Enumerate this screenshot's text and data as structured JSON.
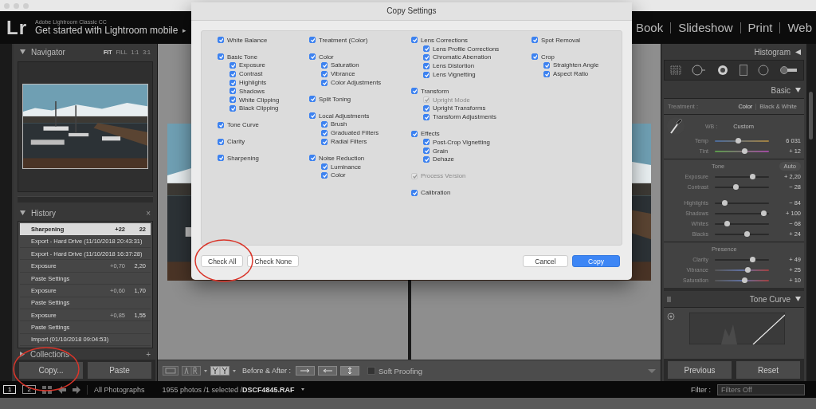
{
  "header": {
    "logo": "Lr",
    "product": "Adobe Lightroom Classic CC",
    "tagline": "Get started with Lightroom mobile",
    "tagline_arrow": "▸",
    "modules": [
      {
        "label": "Book",
        "selected": false
      },
      {
        "label": "Slideshow",
        "selected": false
      },
      {
        "label": "Print",
        "selected": false
      },
      {
        "label": "Web",
        "selected": false
      }
    ]
  },
  "navigator": {
    "title": "Navigator",
    "zoom_options": [
      {
        "label": "FIT",
        "selected": true
      },
      {
        "label": "FILL",
        "selected": false
      },
      {
        "label": "1:1",
        "selected": false
      },
      {
        "label": "3:1",
        "selected": false
      }
    ]
  },
  "history": {
    "title": "History",
    "close": "×",
    "items": [
      {
        "label": "Sharpening",
        "change": "+22",
        "value": "22",
        "selected": true
      },
      {
        "label": "Export - Hard Drive (11/10/2018 20:43:31)",
        "selected": false
      },
      {
        "label": "Export - Hard Drive (11/10/2018 16:37:28)",
        "selected": false
      },
      {
        "label": "Exposure",
        "change": "+0,70",
        "value": "2,20",
        "selected": false
      },
      {
        "label": "Paste Settings",
        "selected": false
      },
      {
        "label": "Exposure",
        "change": "+0,60",
        "value": "1,70",
        "selected": false
      },
      {
        "label": "Paste Settings",
        "selected": false
      },
      {
        "label": "Exposure",
        "change": "+0,85",
        "value": "1,55",
        "selected": false
      },
      {
        "label": "Paste Settings",
        "selected": false
      },
      {
        "label": "Import (01/10/2018 09:04:53)",
        "selected": false
      }
    ]
  },
  "collections": {
    "title": "Collections",
    "add": "+"
  },
  "left_buttons": [
    "Copy...",
    "Paste"
  ],
  "dialog": {
    "title": "Copy Settings",
    "columns": [
      [
        {
          "label": "White Balance",
          "checked": true
        },
        {
          "label": "Basic Tone",
          "checked": true,
          "children": [
            {
              "label": "Exposure",
              "checked": true
            },
            {
              "label": "Contrast",
              "checked": true
            },
            {
              "label": "Highlights",
              "checked": true
            },
            {
              "label": "Shadows",
              "checked": true
            },
            {
              "label": "White Clipping",
              "checked": true
            },
            {
              "label": "Black Clipping",
              "checked": true
            }
          ]
        },
        {
          "label": "Tone Curve",
          "checked": true
        },
        {
          "label": "Clarity",
          "checked": true
        },
        {
          "label": "Sharpening",
          "checked": true
        }
      ],
      [
        {
          "label": "Treatment (Color)",
          "checked": true
        },
        {
          "label": "Color",
          "checked": true,
          "children": [
            {
              "label": "Saturation",
              "checked": true
            },
            {
              "label": "Vibrance",
              "checked": true
            },
            {
              "label": "Color Adjustments",
              "checked": true
            }
          ]
        },
        {
          "label": "Split Toning",
          "checked": true
        },
        {
          "label": "Local Adjustments",
          "checked": true,
          "children": [
            {
              "label": "Brush",
              "checked": true
            },
            {
              "label": "Graduated Filters",
              "checked": true
            },
            {
              "label": "Radial Filters",
              "checked": true
            }
          ]
        },
        {
          "label": "Noise Reduction",
          "checked": true,
          "children": [
            {
              "label": "Luminance",
              "checked": true
            },
            {
              "label": "Color",
              "checked": true
            }
          ]
        }
      ],
      [
        {
          "label": "Lens Corrections",
          "checked": true,
          "children": [
            {
              "label": "Lens Profile Corrections",
              "checked": true
            },
            {
              "label": "Chromatic Aberration",
              "checked": true
            },
            {
              "label": "Lens Distortion",
              "checked": true
            },
            {
              "label": "Lens Vignetting",
              "checked": true
            }
          ]
        },
        {
          "label": "Transform",
          "checked": true,
          "children": [
            {
              "label": "Upright Mode",
              "checked": true,
              "disabled": true
            },
            {
              "label": "Upright Transforms",
              "checked": true
            },
            {
              "label": "Transform Adjustments",
              "checked": true
            }
          ]
        },
        {
          "label": "Effects",
          "checked": true,
          "children": [
            {
              "label": "Post-Crop Vignetting",
              "checked": true
            },
            {
              "label": "Grain",
              "checked": true
            },
            {
              "label": "Dehaze",
              "checked": true
            }
          ]
        },
        {
          "label": "Process Version",
          "checked": true,
          "disabled": true
        },
        {
          "label": "Calibration",
          "checked": true
        }
      ],
      [
        {
          "label": "Spot Removal",
          "checked": true
        },
        {
          "label": "Crop",
          "checked": true,
          "children": [
            {
              "label": "Straighten Angle",
              "checked": true
            },
            {
              "label": "Aspect Ratio",
              "checked": true
            }
          ]
        }
      ]
    ],
    "buttons_left": [
      "Check All",
      "Check None"
    ],
    "buttons_right": [
      {
        "label": "Cancel",
        "default": false
      },
      {
        "label": "Copy",
        "default": true
      }
    ]
  },
  "right_panel": {
    "histogram_title": "Histogram",
    "basic_title": "Basic",
    "treatment_label": "Treatment :",
    "treatments": [
      {
        "label": "Color",
        "selected": true
      },
      {
        "label": "Black & White",
        "selected": false
      }
    ],
    "wb_label": "WB :",
    "wb_value": "Custom",
    "sections": [
      {
        "groups": [
          [
            {
              "label": "Temp",
              "reading": "6 031",
              "level": 0.42,
              "kind": "temp"
            },
            {
              "label": "Tint",
              "reading": "+ 12",
              "level": 0.55,
              "kind": "tint"
            }
          ]
        ]
      },
      {
        "title": "Tone",
        "auto": "Auto",
        "groups": [
          [
            {
              "label": "Exposure",
              "reading": "+ 2,20",
              "level": 0.72,
              "kind": "plain"
            },
            {
              "label": "Contrast",
              "reading": "− 28",
              "level": 0.38,
              "kind": "plain"
            }
          ],
          [
            {
              "label": "Highlights",
              "reading": "− 84",
              "level": 0.14,
              "kind": "plain"
            },
            {
              "label": "Shadows",
              "reading": "+ 100",
              "level": 0.95,
              "kind": "plain"
            },
            {
              "label": "Whites",
              "reading": "− 68",
              "level": 0.2,
              "kind": "plain"
            },
            {
              "label": "Blacks",
              "reading": "+ 24",
              "level": 0.6,
              "kind": "plain"
            }
          ]
        ]
      },
      {
        "title": "Presence",
        "groups": [
          [
            {
              "label": "Clarity",
              "reading": "+ 49",
              "level": 0.72,
              "kind": "plain"
            },
            {
              "label": "Vibrance",
              "reading": "+ 25",
              "level": 0.62,
              "kind": "color"
            },
            {
              "label": "Saturation",
              "reading": "+ 10",
              "level": 0.55,
              "kind": "color"
            }
          ]
        ]
      }
    ],
    "tone_curve_title": "Tone Curve",
    "buttons": [
      "Previous",
      "Reset"
    ]
  },
  "toolbar": {
    "before_after_label": "Before & After :",
    "soft_proofing": {
      "label": "Soft Proofing",
      "checked": false
    }
  },
  "filmstrip": {
    "pages": [
      {
        "label": "1",
        "selected": true
      },
      {
        "label": "2",
        "selected": false
      }
    ],
    "source": "All Photographs",
    "count": "1955 photos /1 selected /",
    "filename": "DSCF4845.RAF",
    "filter_label": "Filter :",
    "filter_value": "Filters Off"
  }
}
